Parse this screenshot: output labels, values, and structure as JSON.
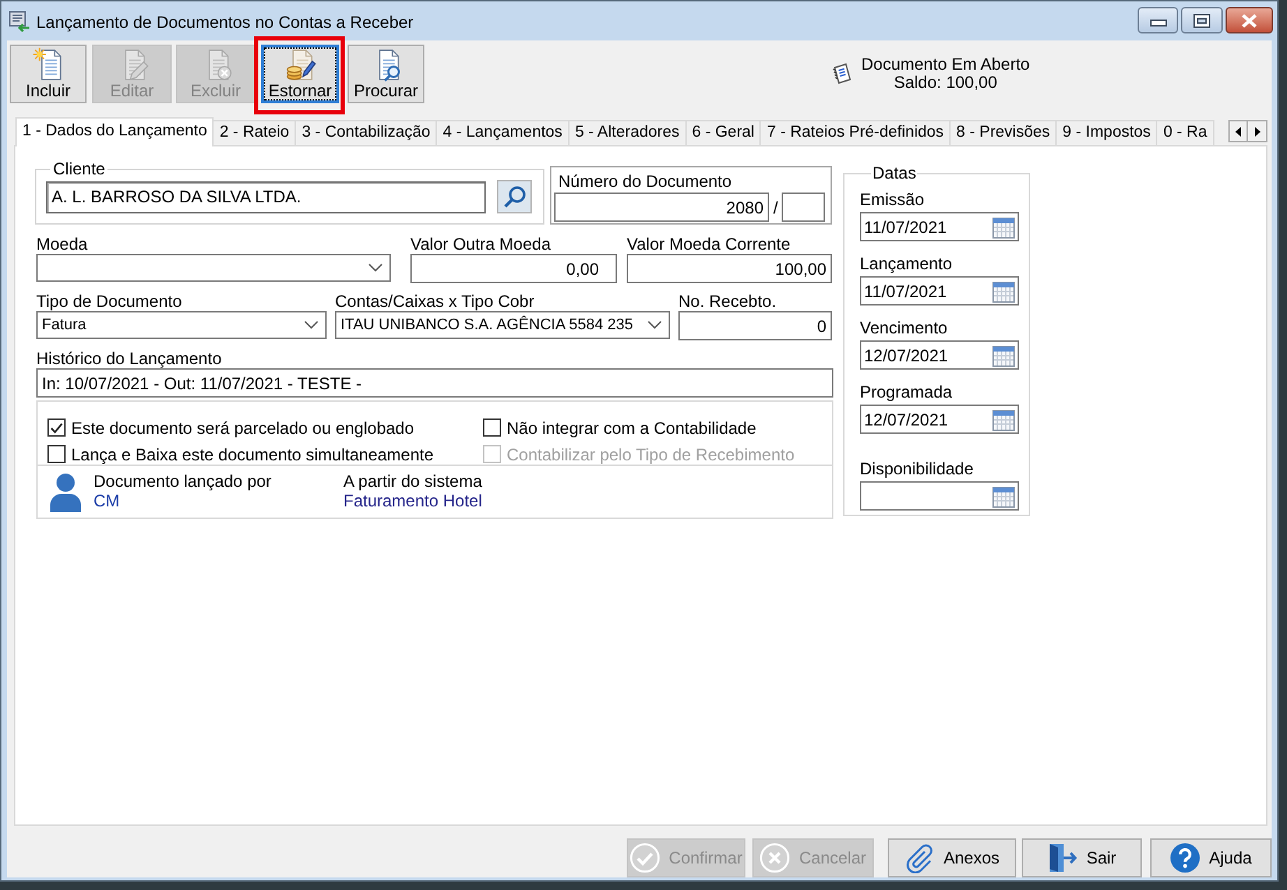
{
  "window": {
    "title": "Lançamento de Documentos no Contas a Receber"
  },
  "toolbar": [
    {
      "kind": "new",
      "label": "Incluir",
      "disabled": false,
      "focused": false,
      "highlighted": false
    },
    {
      "kind": "edit",
      "label": "Editar",
      "disabled": true,
      "focused": false,
      "highlighted": false
    },
    {
      "kind": "delete",
      "label": "Excluir",
      "disabled": true,
      "focused": false,
      "highlighted": false
    },
    {
      "kind": "reverse",
      "label": "Estornar",
      "disabled": false,
      "focused": true,
      "highlighted": true
    },
    {
      "kind": "search",
      "label": "Procurar",
      "disabled": false,
      "focused": false,
      "highlighted": false
    }
  ],
  "document_status": {
    "title": "Documento Em Aberto",
    "balance": "Saldo: 100,00"
  },
  "tabs": [
    {
      "label": "1 - Dados do Lançamento",
      "selected": true
    },
    {
      "label": "2 - Rateio",
      "selected": false
    },
    {
      "label": "3 - Contabilização",
      "selected": false
    },
    {
      "label": "4 - Lançamentos",
      "selected": false
    },
    {
      "label": "5 - Alteradores",
      "selected": false
    },
    {
      "label": "6 - Geral",
      "selected": false
    },
    {
      "label": "7 - Rateios Pré-definidos",
      "selected": false
    },
    {
      "label": "8 - Previsões",
      "selected": false
    },
    {
      "label": "9 - Impostos",
      "selected": false
    },
    {
      "label": "0 - Ra",
      "selected": false
    }
  ],
  "client": {
    "label": "Cliente",
    "value": "A. L. BARROSO DA SILVA LTDA."
  },
  "document_number": {
    "label": "Número do Documento",
    "value": "2080",
    "separator": "/"
  },
  "field_rows": [
    [
      {
        "kind": "select",
        "label": "Moeda"
      },
      {
        "kind": "number",
        "label": "Valor Outra Moeda",
        "value": "0,00"
      },
      {
        "kind": "number",
        "label": "Valor Moeda Corrente",
        "value": "100,00"
      }
    ],
    [
      {
        "kind": "select",
        "label": "Tipo de Documento",
        "value": "Fatura"
      },
      {
        "kind": "select",
        "label": "Contas/Caixas x Tipo Cobr",
        "value": "ITAU UNIBANCO S.A. AGÊNCIA 5584 235"
      },
      {
        "kind": "number",
        "label": "No. Recebto.",
        "value": "0"
      }
    ],
    [
      {
        "kind": "text",
        "label": "Histórico do Lançamento",
        "value": "In: 10/07/2021 - Out: 11/07/2021 - TESTE -"
      }
    ]
  ],
  "options": [
    {
      "label": "Este documento será parcelado ou englobado",
      "checked": true,
      "disabled": false
    },
    {
      "label": "Não integrar com a Contabilidade",
      "checked": false,
      "disabled": false
    },
    {
      "label": "Lança e Baixa este documento simultaneamente",
      "checked": false,
      "disabled": false
    },
    {
      "label": "Contabilizar pelo Tipo de Recebimento",
      "checked": false,
      "disabled": true
    }
  ],
  "origin": {
    "posted_by_label": "Documento lançado por",
    "posted_by": "CM",
    "system_label": "A partir do sistema",
    "system": "Faturamento Hotel"
  },
  "dates": {
    "title": "Datas",
    "fields": [
      {
        "label": "Emissão",
        "value": "11/07/2021"
      },
      {
        "label": "Lançamento",
        "value": "11/07/2021"
      },
      {
        "label": "Vencimento",
        "value": "12/07/2021"
      },
      {
        "label": "Programada",
        "value": "12/07/2021"
      },
      {
        "label": "Disponibilidade"
      }
    ]
  },
  "footer_buttons": [
    {
      "kind": "confirm",
      "label": "Confirmar",
      "disabled": true
    },
    {
      "kind": "cancel",
      "label": "Cancelar",
      "disabled": true
    },
    {
      "kind": "attach",
      "label": "Anexos",
      "disabled": false
    },
    {
      "kind": "exit",
      "label": "Sair",
      "disabled": false
    },
    {
      "kind": "help",
      "label": "Ajuda",
      "disabled": false
    }
  ]
}
